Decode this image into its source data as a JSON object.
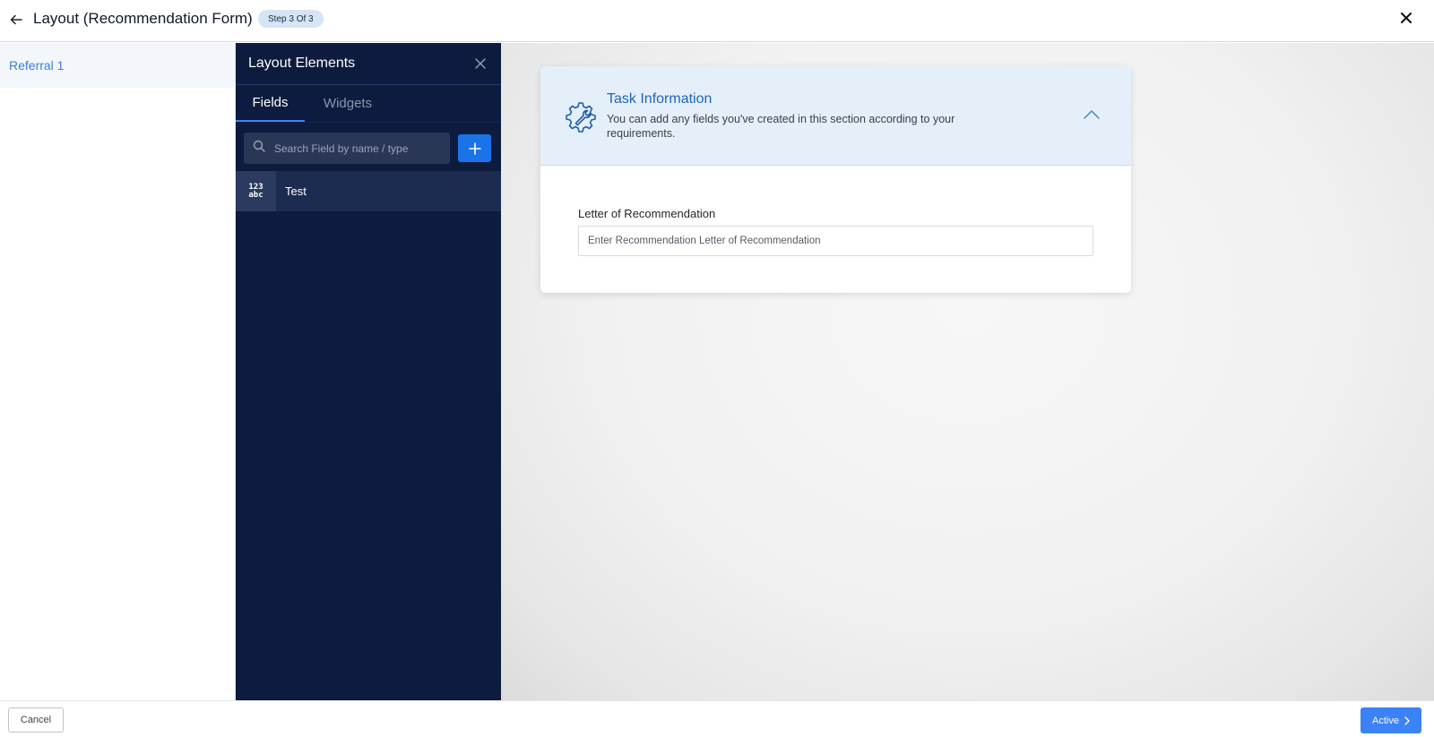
{
  "header": {
    "title": "Layout (Recommendation Form)",
    "step_badge": "Step 3 Of 3"
  },
  "sidebar": {
    "items": [
      {
        "label": "Referral 1",
        "selected": true
      }
    ]
  },
  "elements_panel": {
    "title": "Layout Elements",
    "tabs": [
      {
        "label": "Fields",
        "active": true
      },
      {
        "label": "Widgets",
        "active": false
      }
    ],
    "search": {
      "placeholder": "Search Field by name / type",
      "value": ""
    },
    "fields": [
      {
        "label": "Test",
        "icon": "text-number-icon",
        "icon_text_top": "123",
        "icon_text_bottom": "abc"
      }
    ]
  },
  "section": {
    "title": "Task Information",
    "description": "You can add any fields you've created in this section according to your requirements.",
    "icon": "gear-wrench-icon",
    "expanded": true,
    "fields": [
      {
        "label": "Letter of Recommendation",
        "placeholder": "Enter Recommendation Letter of Recommendation",
        "value": ""
      }
    ]
  },
  "footer": {
    "cancel_label": "Cancel",
    "active_label": "Active"
  },
  "colors": {
    "panel_bg": "#0d1b3e",
    "accent": "#3b82f6",
    "section_header_bg": "#e5eff9",
    "section_title": "#1f66b8",
    "sidebar_link": "#3d7ddb"
  }
}
